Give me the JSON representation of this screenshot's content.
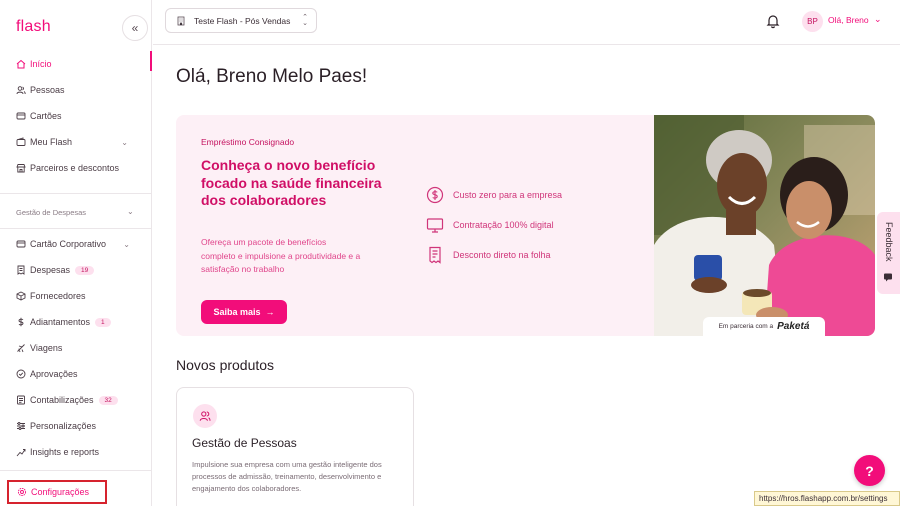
{
  "sidebar": {
    "logo": "flash",
    "collapse_icon": "«",
    "items_top": [
      {
        "label": "Início",
        "icon": "home-icon",
        "active": true
      },
      {
        "label": "Pessoas",
        "icon": "people-icon"
      },
      {
        "label": "Cartões",
        "icon": "card-icon"
      },
      {
        "label": "Meu Flash",
        "icon": "wallet-icon",
        "chevron": true
      },
      {
        "label": "Parceiros e descontos",
        "icon": "store-icon"
      }
    ],
    "section_label": "Gestão de Despesas",
    "items_expenses": [
      {
        "label": "Cartão Corporativo",
        "icon": "card-icon",
        "chevron": true
      },
      {
        "label": "Despesas",
        "icon": "receipt-icon",
        "badge": "19"
      },
      {
        "label": "Fornecedores",
        "icon": "box-icon"
      },
      {
        "label": "Adiantamentos",
        "icon": "dollar-icon",
        "badge": "1"
      },
      {
        "label": "Viagens",
        "icon": "plane-icon"
      },
      {
        "label": "Aprovações",
        "icon": "check-circle-icon"
      },
      {
        "label": "Contabilizações",
        "icon": "ledger-icon",
        "badge": "32"
      },
      {
        "label": "Personalizações",
        "icon": "sliders-icon"
      },
      {
        "label": "Insights e reports",
        "icon": "chart-icon"
      }
    ],
    "settings_label": "Configurações"
  },
  "topbar": {
    "company": "Teste Flash - Pós Vendas",
    "avatar_initials": "BP",
    "greeting": "Olá, Breno"
  },
  "main": {
    "title": "Olá, Breno Melo Paes!",
    "banner": {
      "eyebrow": "Empréstimo Consignado",
      "title": "Conheça o novo benefício focado na saúde financeira dos colaboradores",
      "description": "Ofereça um pacote de benefícios completo e impulsione a produtividade e a satisfação no trabalho",
      "cta": "Saiba mais",
      "benefits": [
        {
          "label": "Custo zero para a empresa",
          "icon": "dollar-circle-icon"
        },
        {
          "label": "Contratação 100% digital",
          "icon": "monitor-icon"
        },
        {
          "label": "Desconto direto na folha",
          "icon": "document-icon"
        }
      ],
      "partner_prefix": "Em parceria com a",
      "partner_name": "Paketá"
    },
    "products_title": "Novos produtos",
    "product": {
      "title": "Gestão de Pessoas",
      "description": "Impulsione sua empresa com uma gestão inteligente dos processos de admissão, treinamento, desenvolvimento e engajamento dos colaboradores."
    }
  },
  "feedback_label": "Feedback",
  "help_label": "?",
  "status_url": "https://hros.flashapp.com.br/settings",
  "colors": {
    "accent": "#f20d7a",
    "banner_bg": "#fdf0f6",
    "badge_bg": "#fde0ee"
  }
}
